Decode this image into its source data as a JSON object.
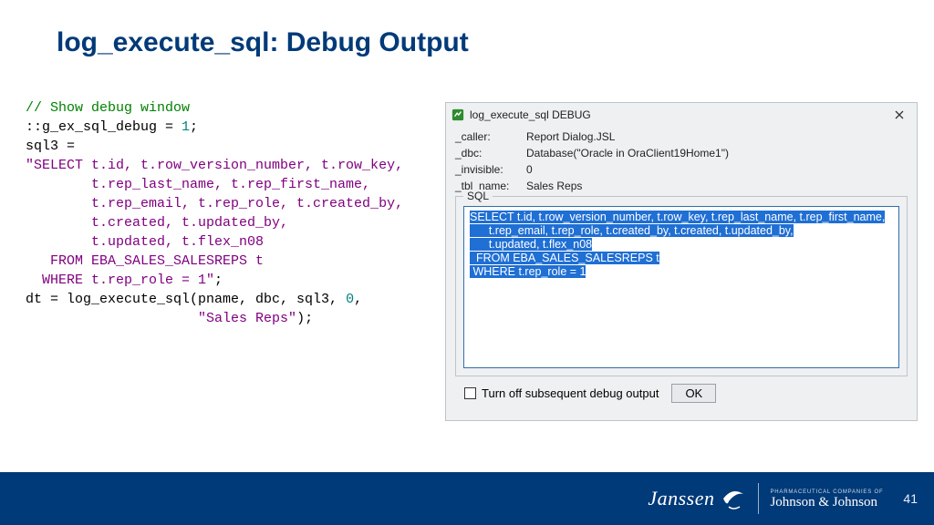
{
  "title": "log_execute_sql: Debug Output",
  "code": {
    "comment": "// Show debug window",
    "l1a": "::g_ex_sql_debug = ",
    "l1_num": "1",
    "l1b": ";",
    "l2": "sql3 =",
    "sql_open": "\"SELECT t.id, t.row_version_number, t.row_key,",
    "sql_l2": "        t.rep_last_name, t.rep_first_name,",
    "sql_l3": "        t.rep_email, t.rep_role, t.created_by,",
    "sql_l4": "        t.created, t.updated_by,",
    "sql_l5": "        t.updated, t.flex_n08",
    "sql_l6": "   FROM EBA_SALES_SALESREPS t",
    "sql_l7": "  WHERE t.rep_role = 1\"",
    "l_semi": ";",
    "call_a": "dt = log_execute_sql(pname, dbc, sql3, ",
    "call_num": "0",
    "call_b": ",",
    "call_c": "                     ",
    "call_str": "\"Sales Reps\"",
    "call_d": ");"
  },
  "dialog": {
    "title": "log_execute_sql DEBUG",
    "fields": {
      "caller_k": "_caller:",
      "caller_v": "Report Dialog.JSL",
      "dbc_k": "_dbc:",
      "dbc_v": "Database(\"Oracle in OraClient19Home1\")",
      "invisible_k": "_invisible:",
      "invisible_v": "0",
      "tbl_k": "_tbl_name:",
      "tbl_v": "Sales Reps"
    },
    "sql_legend": "SQL",
    "sql_lines": {
      "l1": "SELECT t.id, t.row_version_number, t.row_key, t.rep_last_name, t.rep_first_name,",
      "l2": "      t.rep_email, t.rep_role, t.created_by, t.created, t.updated_by,",
      "l3": "      t.updated, t.flex_n08",
      "l4": "  FROM EBA_SALES_SALESREPS t",
      "l5": " WHERE t.rep_role = 1"
    },
    "checkbox_label": "Turn off subsequent debug output",
    "ok_label": "OK"
  },
  "footer": {
    "brand1": "Janssen",
    "brand2_small": "PHARMACEUTICAL COMPANIES OF",
    "brand2_script": "Johnson & Johnson",
    "page": "41"
  }
}
